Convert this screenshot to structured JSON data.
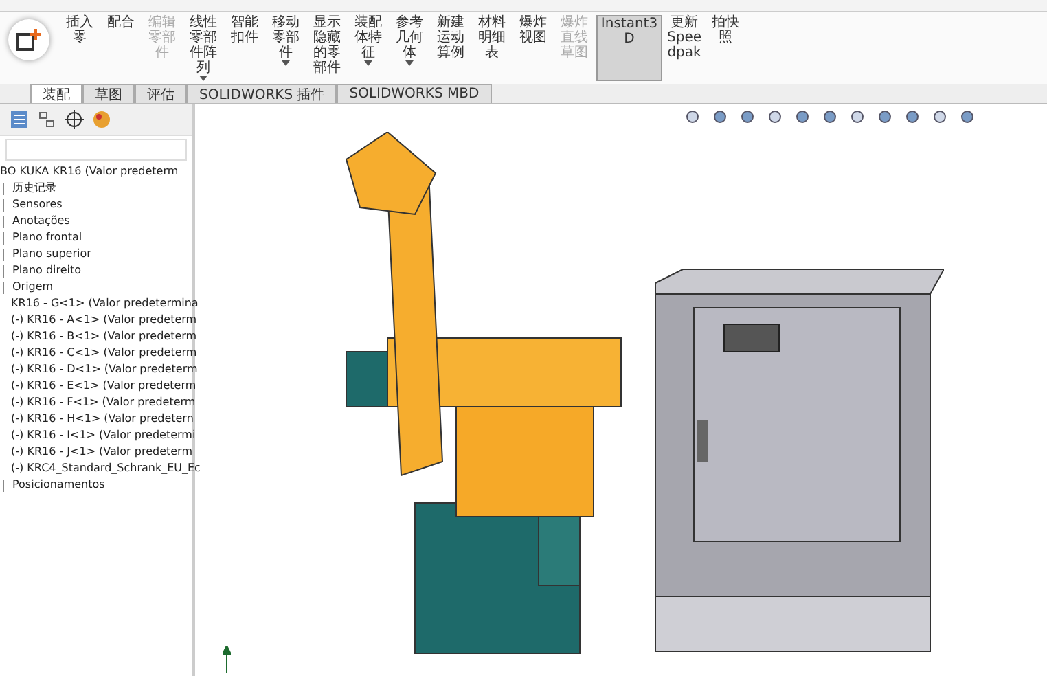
{
  "ribbon": {
    "buttons": [
      {
        "label": "插入零",
        "disabled": false,
        "selected": false,
        "dropdown": false
      },
      {
        "label": "配合",
        "disabled": false,
        "selected": false,
        "dropdown": false
      },
      {
        "label": "编辑零部件",
        "disabled": true,
        "selected": false,
        "dropdown": false
      },
      {
        "label": "线性零部件阵列",
        "disabled": false,
        "selected": false,
        "dropdown": true
      },
      {
        "label": "智能扣件",
        "disabled": false,
        "selected": false,
        "dropdown": false
      },
      {
        "label": "移动零部件",
        "disabled": false,
        "selected": false,
        "dropdown": true
      },
      {
        "label": "显示隐藏的零部件",
        "disabled": false,
        "selected": false,
        "dropdown": false
      },
      {
        "label": "装配体特征",
        "disabled": false,
        "selected": false,
        "dropdown": true
      },
      {
        "label": "参考几何体",
        "disabled": false,
        "selected": false,
        "dropdown": true
      },
      {
        "label": "新建运动算例",
        "disabled": false,
        "selected": false,
        "dropdown": false
      },
      {
        "label": "材料明细表",
        "disabled": false,
        "selected": false,
        "dropdown": false
      },
      {
        "label": "爆炸视图",
        "disabled": false,
        "selected": false,
        "dropdown": false
      },
      {
        "label": "爆炸直线草图",
        "disabled": true,
        "selected": false,
        "dropdown": false
      },
      {
        "label": "Instant3D",
        "disabled": false,
        "selected": true,
        "dropdown": false
      },
      {
        "label": "更新 Speedpak",
        "disabled": false,
        "selected": false,
        "dropdown": false
      },
      {
        "label": "拍快照",
        "disabled": false,
        "selected": false,
        "dropdown": false
      }
    ]
  },
  "tabs": [
    {
      "label": "装配",
      "selected": true
    },
    {
      "label": "草图",
      "selected": false
    },
    {
      "label": "评估",
      "selected": false
    },
    {
      "label": "SOLIDWORKS 插件",
      "selected": false
    },
    {
      "label": "SOLIDWORKS MBD",
      "selected": false
    }
  ],
  "tree": {
    "root": "BO KUKA KR16  (Valor predeterm",
    "items": [
      {
        "label": "历史记录"
      },
      {
        "label": "Sensores"
      },
      {
        "label": "Anotações"
      },
      {
        "label": "Plano frontal"
      },
      {
        "label": "Plano superior"
      },
      {
        "label": "Plano direito"
      },
      {
        "label": "Origem"
      },
      {
        "label": "KR16 - G<1> (Valor predetermina"
      },
      {
        "label": "(-) KR16 - A<1> (Valor predeterm"
      },
      {
        "label": "(-) KR16 - B<1> (Valor predeterm"
      },
      {
        "label": "(-) KR16 - C<1> (Valor predeterm"
      },
      {
        "label": "(-) KR16 - D<1> (Valor predeterm"
      },
      {
        "label": "(-) KR16 - E<1> (Valor predeterm"
      },
      {
        "label": "(-) KR16 - F<1> (Valor predeterm"
      },
      {
        "label": "(-) KR16 - H<1> (Valor predetern"
      },
      {
        "label": "(-) KR16 - I<1> (Valor predetermi"
      },
      {
        "label": "(-) KR16 - J<1> (Valor predeterm"
      },
      {
        "label": "(-) KRC4_Standard_Schrank_EU_Ec"
      },
      {
        "label": "Posicionamentos"
      }
    ]
  }
}
